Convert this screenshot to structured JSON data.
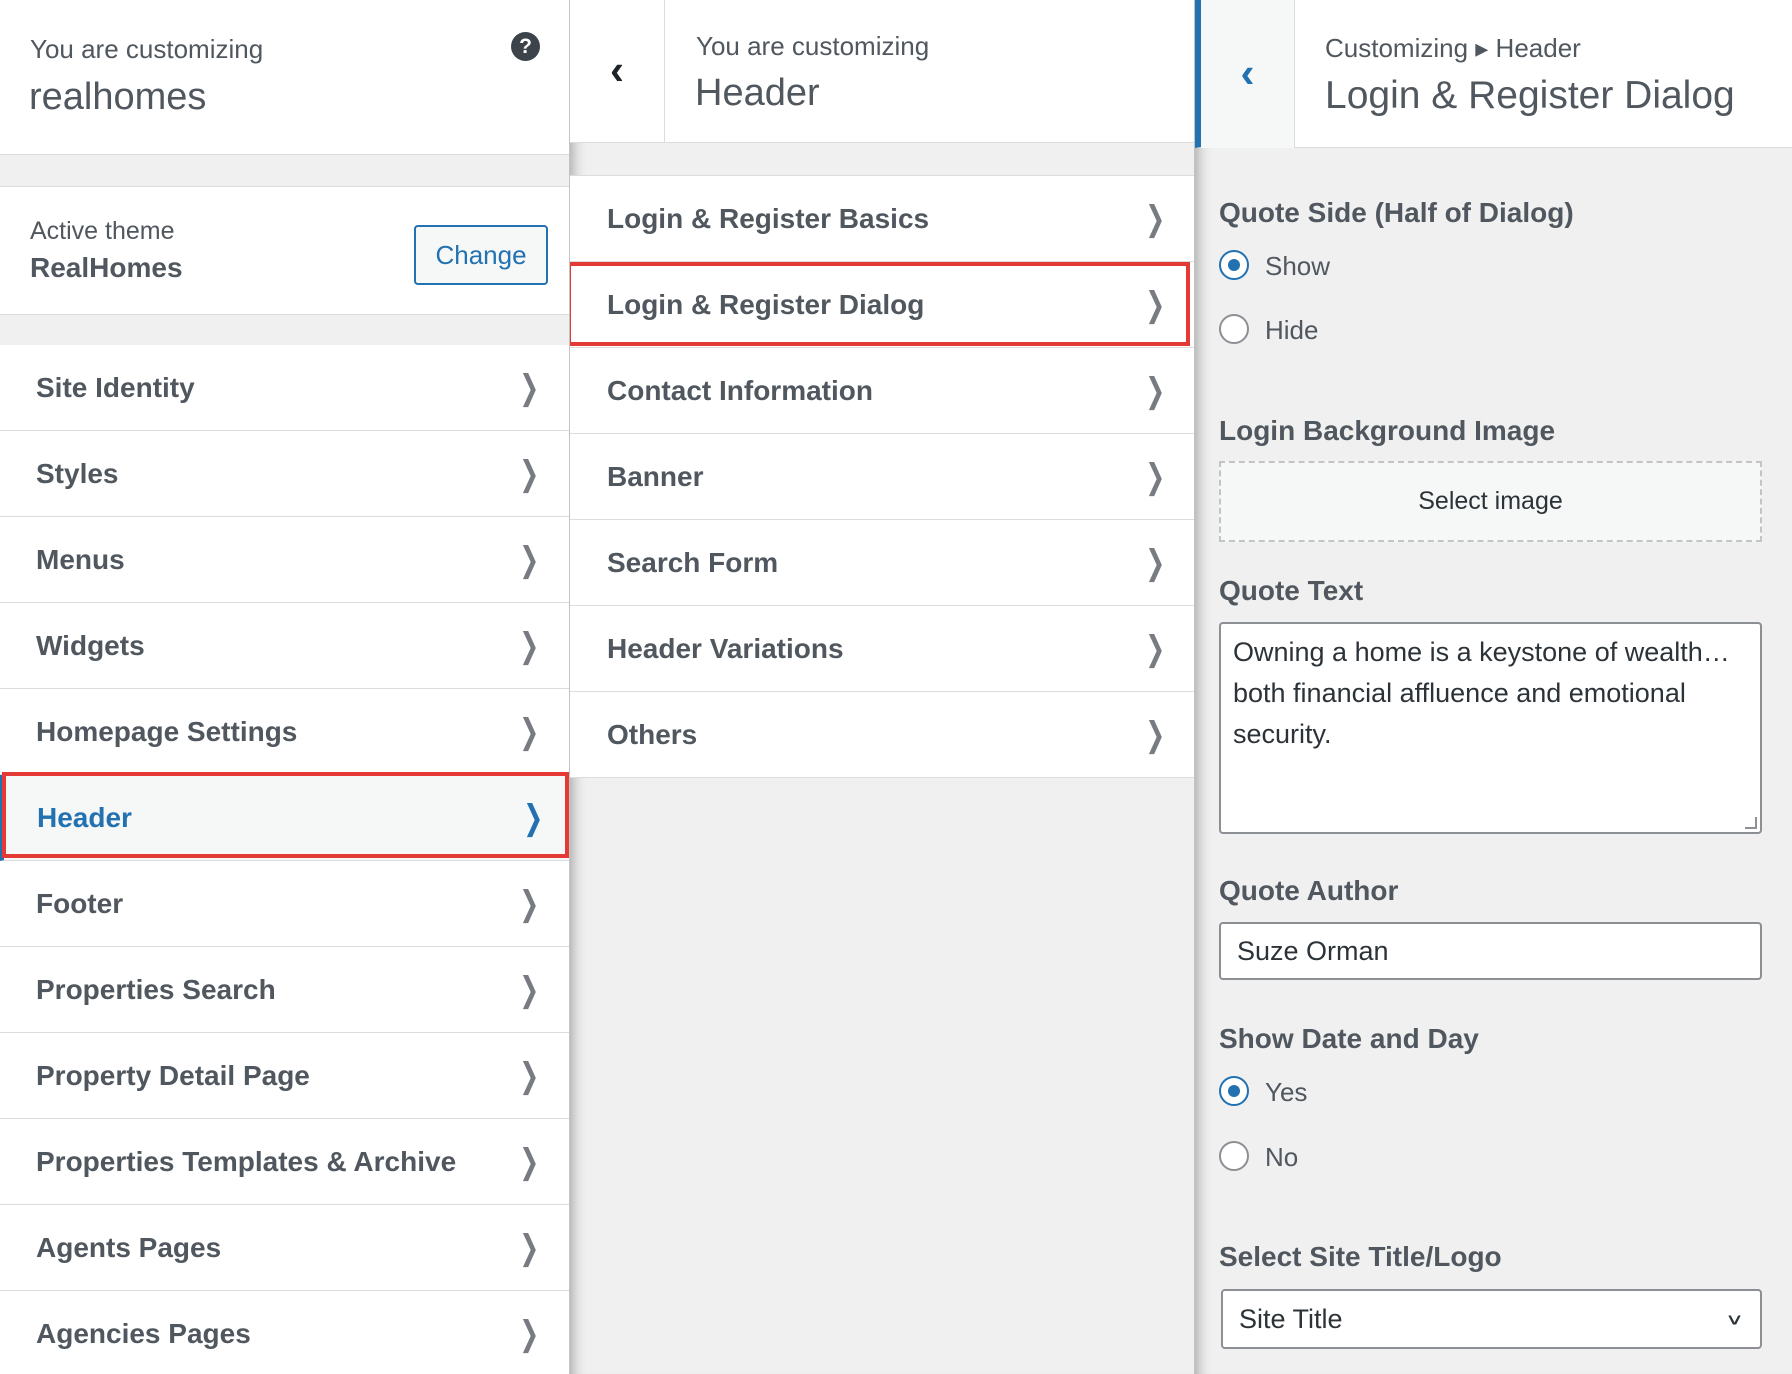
{
  "colors": {
    "accent": "#2271b1",
    "highlight": "#e53935",
    "text": "#50575e",
    "background": "#f0f0f1"
  },
  "icons": {
    "help": "help-icon",
    "chevron": "chevron-right-icon",
    "back": "chevron-left-icon",
    "caret": "chevron-down-icon"
  },
  "panel1": {
    "customizing_label": "You are customizing",
    "site_name": "realhomes",
    "help_glyph": "?",
    "active_theme_label": "Active theme",
    "theme_name": "RealHomes",
    "change_button": "Change",
    "items": [
      {
        "label": "Site Identity"
      },
      {
        "label": "Styles"
      },
      {
        "label": "Menus"
      },
      {
        "label": "Widgets"
      },
      {
        "label": "Homepage Settings"
      },
      {
        "label": "Header"
      },
      {
        "label": "Footer"
      },
      {
        "label": "Properties Search"
      },
      {
        "label": "Property Detail Page"
      },
      {
        "label": "Properties Templates & Archive"
      },
      {
        "label": "Agents Pages"
      },
      {
        "label": "Agencies Pages"
      }
    ]
  },
  "panel2": {
    "customizing_label": "You are customizing",
    "section_title": "Header",
    "items": [
      {
        "label": "Login & Register Basics"
      },
      {
        "label": "Login & Register Dialog"
      },
      {
        "label": "Contact Information"
      },
      {
        "label": "Banner"
      },
      {
        "label": "Search Form"
      },
      {
        "label": "Header Variations"
      },
      {
        "label": "Others"
      }
    ]
  },
  "panel3": {
    "breadcrumb": "Customizing ▸ Header",
    "title": "Login & Register Dialog",
    "quote_side": {
      "label": "Quote Side (Half of Dialog)",
      "options": [
        "Show",
        "Hide"
      ],
      "selected": "Show"
    },
    "login_bg": {
      "label": "Login Background Image",
      "button": "Select image"
    },
    "quote_text": {
      "label": "Quote Text",
      "value": "Owning a home is a keystone of wealth… both financial affluence and emotional security."
    },
    "quote_author": {
      "label": "Quote Author",
      "value": "Suze Orman"
    },
    "show_date": {
      "label": "Show Date and Day",
      "options": [
        "Yes",
        "No"
      ],
      "selected": "Yes"
    },
    "site_title_logo": {
      "label": "Select Site Title/Logo",
      "value": "Site Title"
    }
  }
}
